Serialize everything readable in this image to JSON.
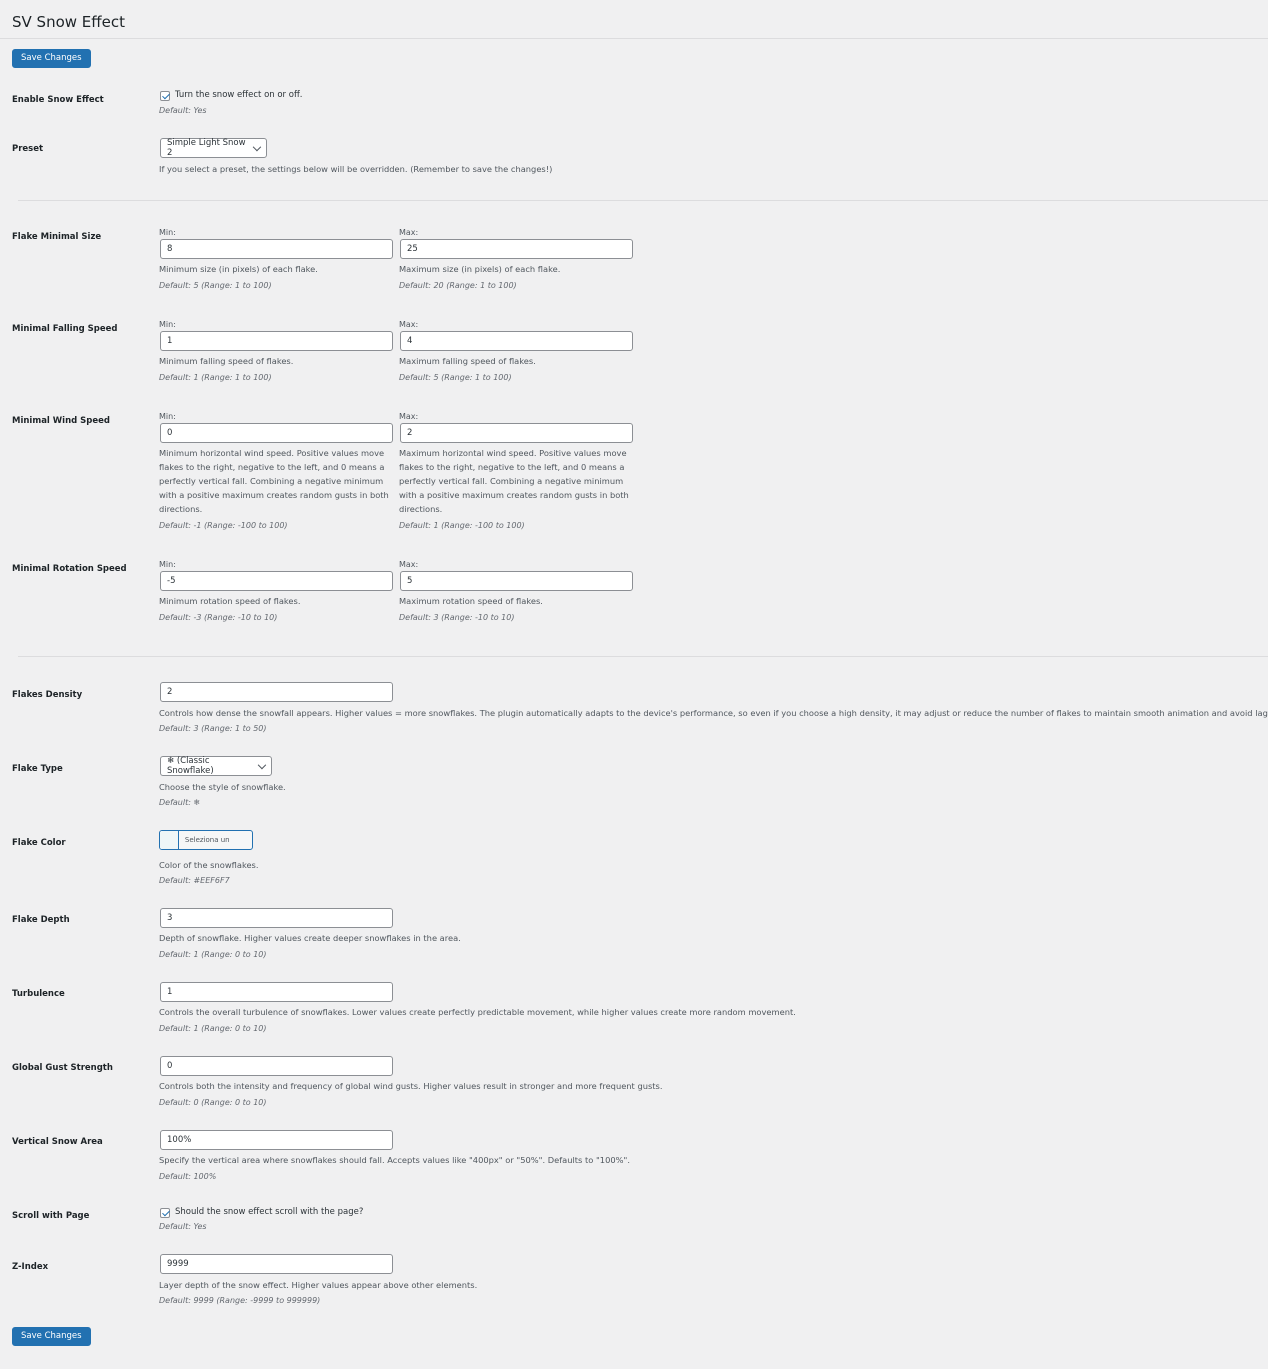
{
  "page": {
    "title": "SV Snow Effect",
    "save_label": "Save Changes"
  },
  "enable": {
    "label": "Enable Snow Effect",
    "checkbox_text": "Turn the snow effect on or off.",
    "default": "Default: Yes"
  },
  "preset": {
    "label": "Preset",
    "value": "Simple Light Snow 2",
    "desc": "If you select a preset, the settings below will be overridden. (Remember to save the changes!)"
  },
  "min_label": "Min:",
  "max_label": "Max:",
  "flake_size": {
    "label": "Flake Minimal Size",
    "min_value": "8",
    "max_value": "25",
    "min_desc": "Minimum size (in pixels) of each flake.",
    "max_desc": "Maximum size (in pixels) of each flake.",
    "min_default": "Default: 5 (Range: 1 to 100)",
    "max_default": "Default: 20 (Range: 1 to 100)"
  },
  "falling_speed": {
    "label": "Minimal Falling Speed",
    "min_value": "1",
    "max_value": "4",
    "min_desc": "Minimum falling speed of flakes.",
    "max_desc": "Maximum falling speed of flakes.",
    "min_default": "Default: 1 (Range: 1 to 100)",
    "max_default": "Default: 5 (Range: 1 to 100)"
  },
  "wind_speed": {
    "label": "Minimal Wind Speed",
    "min_value": "0",
    "max_value": "2",
    "min_desc_lines": [
      "Minimum horizontal wind speed. Positive values move",
      "flakes to the right, negative to the left, and 0 means a",
      "perfectly vertical fall. Combining a negative minimum",
      "with a positive maximum creates random gusts in both",
      "directions."
    ],
    "max_desc_lines": [
      "Maximum horizontal wind speed. Positive values move",
      "flakes to the right, negative to the left, and 0 means a",
      "perfectly vertical fall. Combining a negative minimum",
      "with a positive maximum creates random gusts in both",
      "directions."
    ],
    "min_default": "Default: -1 (Range: -100 to 100)",
    "max_default": "Default: 1 (Range: -100 to 100)"
  },
  "rotation_speed": {
    "label": "Minimal Rotation Speed",
    "min_value": "-5",
    "max_value": "5",
    "min_desc": "Minimum rotation speed of flakes.",
    "max_desc": "Maximum rotation speed of flakes.",
    "min_default": "Default: -3 (Range: -10 to 10)",
    "max_default": "Default: 3 (Range: -10 to 10)"
  },
  "density": {
    "label": "Flakes Density",
    "value": "2",
    "desc": "Controls how dense the snowfall appears. Higher values = more snowflakes. The plugin automatically adapts to the device's performance, so even if you choose a high density, it may adjust or reduce the number of flakes to maintain smooth animation and avoid lag.",
    "default": "Default: 3 (Range: 1 to 50)"
  },
  "flake_type": {
    "label": "Flake Type",
    "value": "❄ (Classic Snowflake)",
    "desc": "Choose the style of snowflake.",
    "default": "Default: ❄"
  },
  "flake_color": {
    "label": "Flake Color",
    "button_text": "Seleziona un colore",
    "swatch": "#EEF6F7",
    "desc": "Color of the snowflakes.",
    "default": "Default: #EEF6F7"
  },
  "depth": {
    "label": "Flake Depth",
    "value": "3",
    "desc": "Depth of snowflake. Higher values create deeper snowflakes in the area.",
    "default": "Default: 1 (Range: 0 to 10)"
  },
  "turbulence": {
    "label": "Turbulence",
    "value": "1",
    "desc": "Controls the overall turbulence of snowflakes. Lower values create perfectly predictable movement, while higher values create more random movement.",
    "default": "Default: 1 (Range: 0 to 10)"
  },
  "gust": {
    "label": "Global Gust Strength",
    "value": "0",
    "desc": "Controls both the intensity and frequency of global wind gusts. Higher values result in stronger and more frequent gusts.",
    "default": "Default: 0 (Range: 0 to 10)"
  },
  "vertical_area": {
    "label": "Vertical Snow Area",
    "value": "100%",
    "desc": "Specify the vertical area where snowflakes should fall. Accepts values like \"400px\" or \"50%\". Defaults to \"100%\".",
    "default": "Default: 100%"
  },
  "scroll": {
    "label": "Scroll with Page",
    "checkbox_text": "Should the snow effect scroll with the page?",
    "default": "Default: Yes"
  },
  "zindex": {
    "label": "Z-Index",
    "value": "9999",
    "desc": "Layer depth of the snow effect. Higher values appear above other elements.",
    "default": "Default: 9999 (Range: -9999 to 999999)"
  }
}
